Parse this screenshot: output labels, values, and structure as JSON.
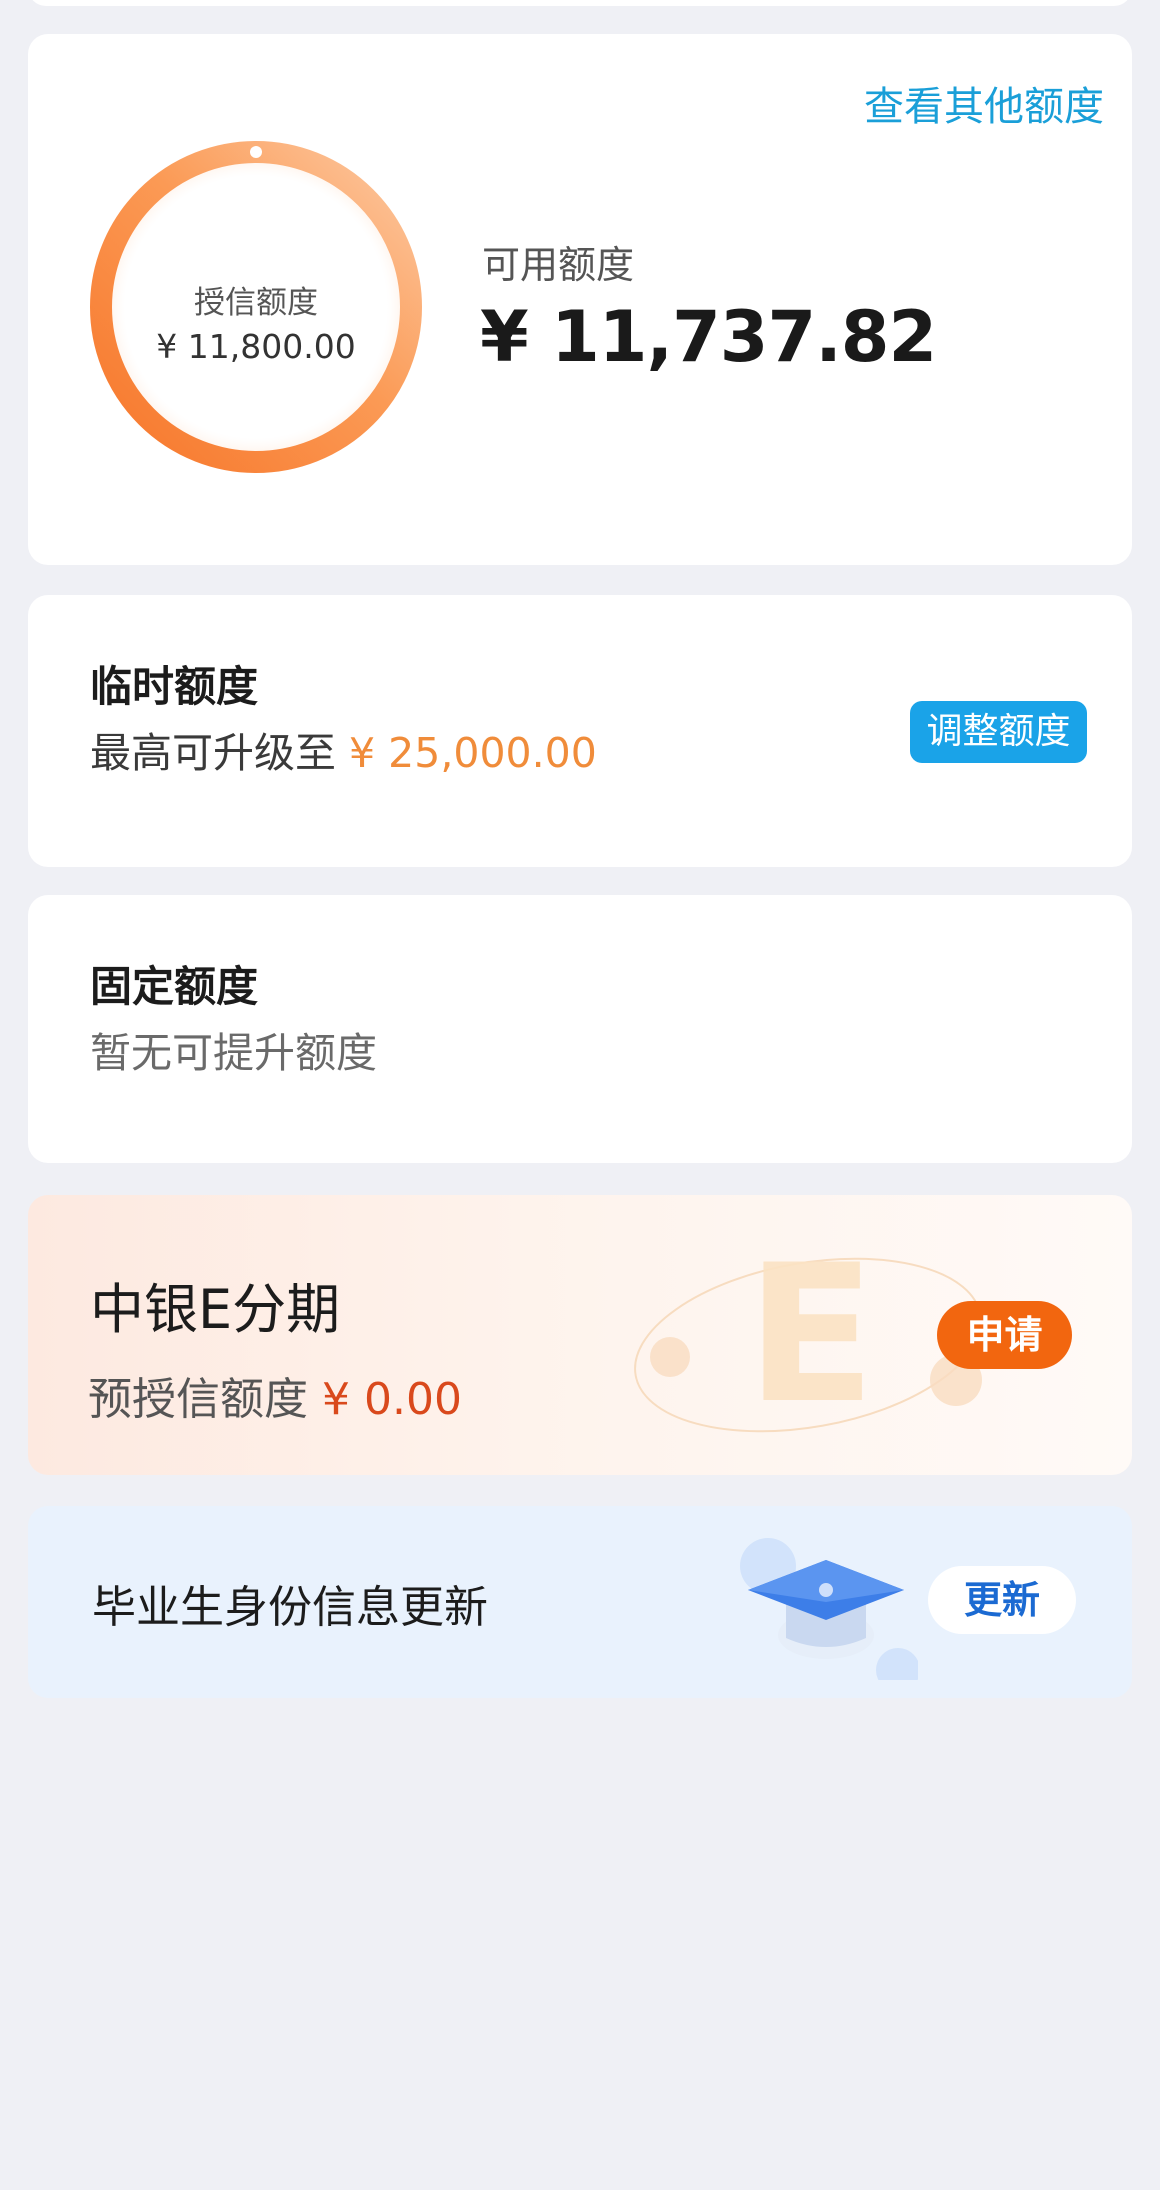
{
  "summary": {
    "other_link": "查看其他额度",
    "ring_label": "授信额度",
    "ring_value": "¥ 11,800.00",
    "available_label": "可用额度",
    "available_value": "¥ 11,737.82",
    "ring_used_fraction": 0.005
  },
  "temp": {
    "title": "临时额度",
    "sub_prefix": "最高可升级至",
    "sub_amount": "¥ 25,000.00",
    "button": "调整额度"
  },
  "fixed": {
    "title": "固定额度",
    "sub": "暂无可提升额度"
  },
  "einst": {
    "title": "中银E分期",
    "sub_prefix": "预授信额度",
    "sub_amount": "¥ 0.00",
    "button": "申请"
  },
  "grad": {
    "title": "毕业生身份信息更新",
    "button": "更新"
  },
  "colors": {
    "accent_blue": "#1aa3e8",
    "orange": "#f08c3a",
    "apply_orange": "#f2660f",
    "link_blue": "#1a9fd8"
  },
  "icons": [
    "ring-progress-icon",
    "e-logo-icon",
    "graduation-cap-icon"
  ]
}
